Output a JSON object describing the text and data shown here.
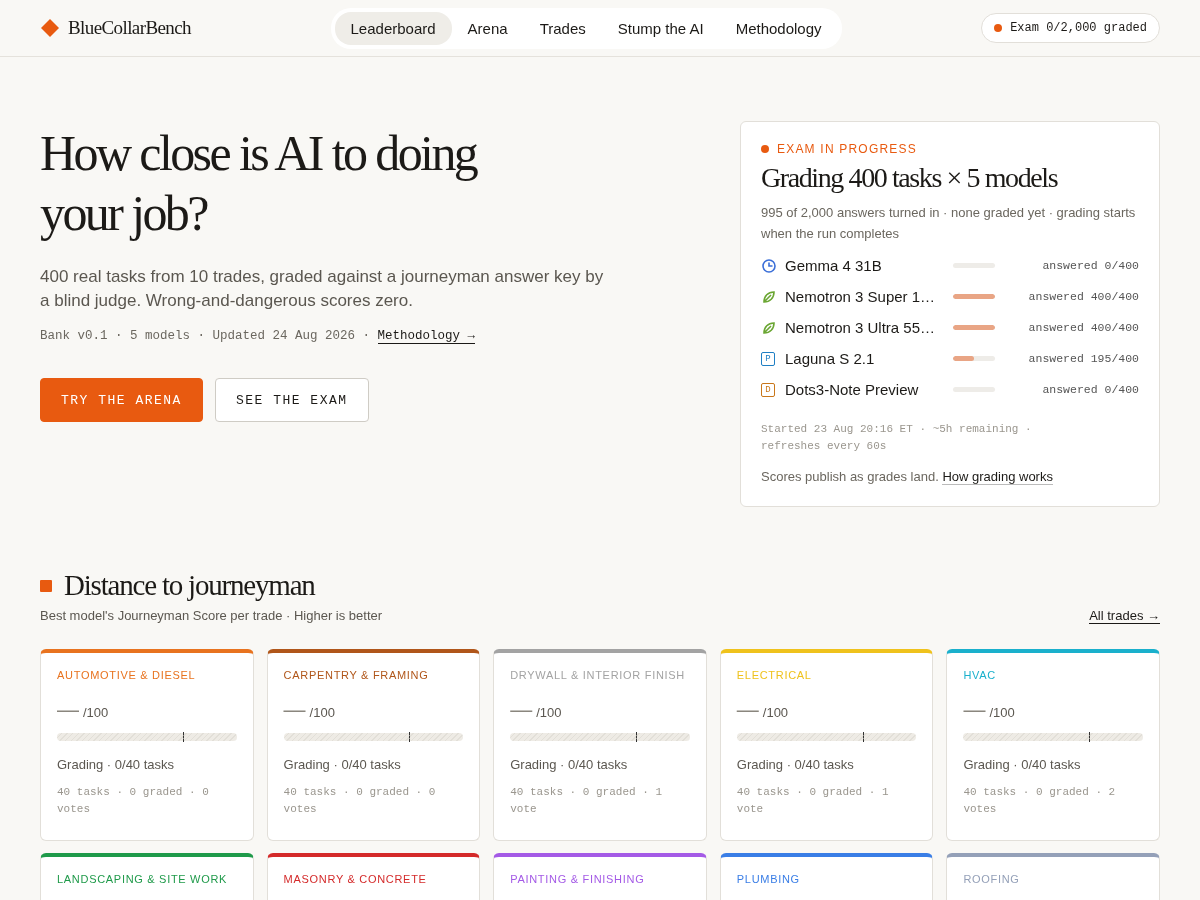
{
  "brand": {
    "name": "BlueCollarBench"
  },
  "nav": [
    {
      "label": "Leaderboard",
      "selected": true
    },
    {
      "label": "Arena",
      "selected": false
    },
    {
      "label": "Trades",
      "selected": false
    },
    {
      "label": "Stump the AI",
      "selected": false
    },
    {
      "label": "Methodology",
      "selected": false
    }
  ],
  "status_pill": {
    "label": "Exam 0/2,000 graded"
  },
  "hero": {
    "title": "How close is AI to doing your job?",
    "lead": "400 real tasks from 10 trades, graded against a journeyman answer key by a blind judge. Wrong-and-dangerous scores zero.",
    "meta": "Bank v0.1 · 5 models · Updated 24 Aug 2026 · ",
    "meta_link": "Methodology →",
    "buttons": [
      {
        "label": "TRY THE ARENA",
        "kind": "primary"
      },
      {
        "label": "SEE THE EXAM",
        "kind": "secondary"
      }
    ]
  },
  "exam": {
    "eyebrow": "EXAM IN PROGRESS",
    "title": "Grading 400 tasks × 5 models",
    "summary": "995 of 2,000 answers turned in · none graded yet · grading starts when the run completes",
    "models": [
      {
        "name": "Gemma 4 31B",
        "kind": "clock",
        "color": "#3b6fd8",
        "level": 0,
        "reading": "answered 0/400"
      },
      {
        "name": "Nemotron 3 Super 1…",
        "kind": "leaf",
        "color": "#6aa632",
        "level": 1,
        "reading": "answered 400/400"
      },
      {
        "name": "Nemotron 3 Ultra 55…",
        "kind": "leaf",
        "color": "#6aa632",
        "level": 1,
        "reading": "answered 400/400"
      },
      {
        "name": "Laguna S 2.1",
        "kind": "letter",
        "letter": "P",
        "color": "#1f7fc4",
        "level": 0.49,
        "reading": "answered 195/400"
      },
      {
        "name": "Dots3-Note Preview",
        "kind": "letter",
        "letter": "D",
        "color": "#c9771a",
        "level": 0,
        "reading": "answered 0/400"
      }
    ],
    "footer_meta": "Started 23 Aug 20:16 ET · ~5h remaining · refreshes every 60s",
    "note": "Scores publish as grades land. ",
    "note_link": "How grading works"
  },
  "distance": {
    "title": "Distance to journeyman",
    "subtitle": "Best model's Journeyman Score per trade · Higher is better",
    "all_link": "All trades →",
    "trades": [
      {
        "name": "AUTOMOTIVE & DIESEL",
        "color": "#e8731f",
        "score": "—",
        "out_of": "/100",
        "status": "Grading · 0/40 tasks",
        "meta": "40 tasks · 0 graded · 0 votes"
      },
      {
        "name": "CARPENTRY & FRAMING",
        "color": "#b0561a",
        "score": "—",
        "out_of": "/100",
        "status": "Grading · 0/40 tasks",
        "meta": "40 tasks · 0 graded · 0 votes"
      },
      {
        "name": "DRYWALL & INTERIOR FINISH",
        "color": "#a3a3a3",
        "score": "—",
        "out_of": "/100",
        "status": "Grading · 0/40 tasks",
        "meta": "40 tasks · 0 graded · 1 vote"
      },
      {
        "name": "ELECTRICAL",
        "color": "#efc21c",
        "score": "—",
        "out_of": "/100",
        "status": "Grading · 0/40 tasks",
        "meta": "40 tasks · 0 graded · 1 vote"
      },
      {
        "name": "HVAC",
        "color": "#1ab0cc",
        "score": "—",
        "out_of": "/100",
        "status": "Grading · 0/40 tasks",
        "meta": "40 tasks · 0 graded · 2 votes"
      },
      {
        "name": "LANDSCAPING & SITE WORK",
        "color": "#1f9a4a"
      },
      {
        "name": "MASONRY & CONCRETE",
        "color": "#d42a2a"
      },
      {
        "name": "PAINTING & FINISHING",
        "color": "#a45ae6"
      },
      {
        "name": "PLUMBING",
        "color": "#3a7ee6"
      },
      {
        "name": "ROOFING",
        "color": "#94a0b8"
      }
    ]
  }
}
